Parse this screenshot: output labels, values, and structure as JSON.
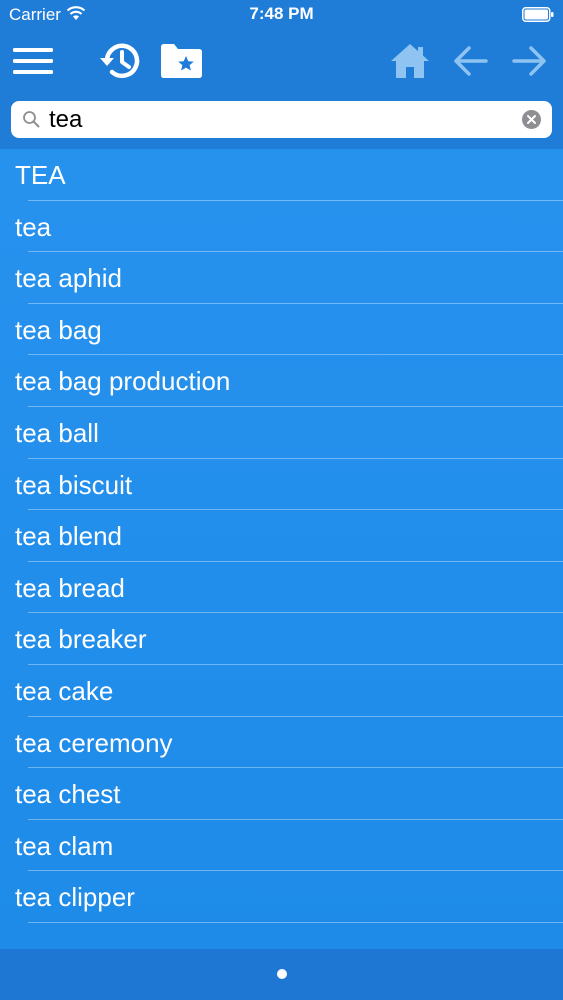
{
  "status_bar": {
    "carrier": "Carrier",
    "time": "7:48 PM"
  },
  "toolbar": {
    "icons": [
      "menu-icon",
      "history-icon",
      "favorites-folder-icon",
      "home-icon",
      "back-arrow-icon",
      "forward-arrow-icon"
    ]
  },
  "search": {
    "value": "tea",
    "placeholder": ""
  },
  "results": [
    "TEA",
    "tea",
    "tea aphid",
    "tea bag",
    "tea bag production",
    "tea ball",
    "tea biscuit",
    "tea blend",
    "tea bread",
    "tea breaker",
    "tea cake",
    "tea ceremony",
    "tea chest",
    "tea clam",
    "tea clipper"
  ],
  "colors": {
    "header": "#1f7cd7",
    "list_background": "#2792ee",
    "disabled_icon": "#8ec3f2",
    "text": "#ffffff"
  }
}
